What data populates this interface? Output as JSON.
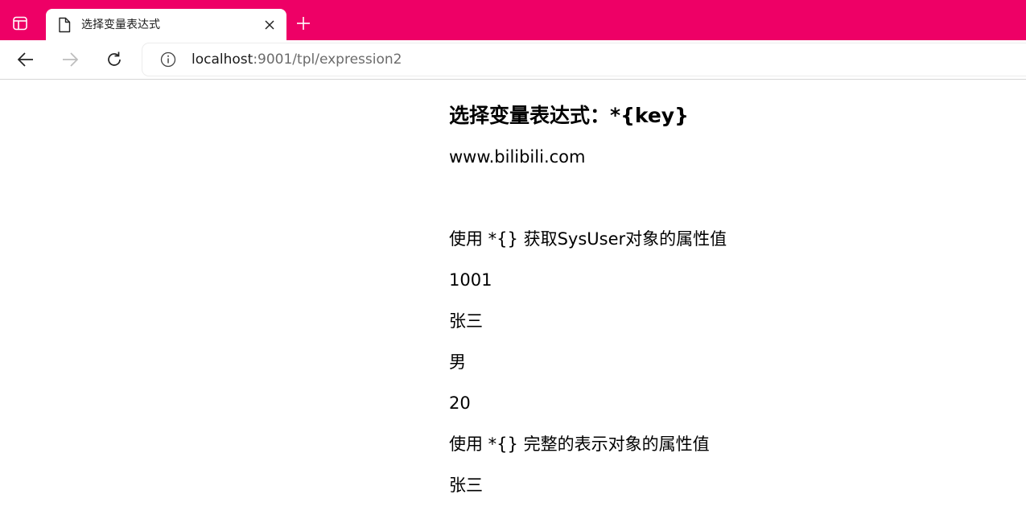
{
  "browser": {
    "accent_color": "#ee0066",
    "tab": {
      "title": "选择变量表达式",
      "icon": "document-icon"
    },
    "address_bar": {
      "host": "localhost",
      "path": ":9001/tpl/expression2"
    }
  },
  "page": {
    "heading": "选择变量表达式：*{key}",
    "site": "www.bilibili.com",
    "section1_label": "使用 *{} 获取SysUser对象的属性值",
    "user_id": "1001",
    "user_name": "张三",
    "user_sex": "男",
    "user_age": "20",
    "section2_label": "使用 *{} 完整的表示对象的属性值",
    "full_user_name": "张三"
  }
}
